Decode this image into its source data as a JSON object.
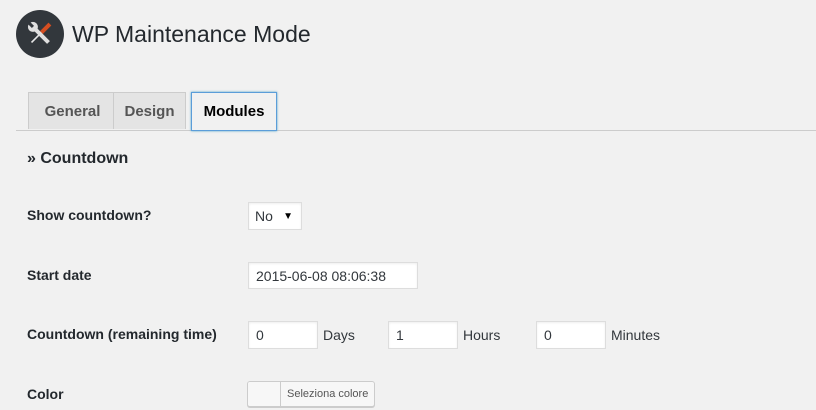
{
  "app": {
    "title": "WP Maintenance Mode",
    "logo_icon": "wrench-screwdriver-icon"
  },
  "tabs": [
    {
      "label": "General",
      "active": false
    },
    {
      "label": "Design",
      "active": false
    },
    {
      "label": "Modules",
      "active": true
    }
  ],
  "section": {
    "title": "» Countdown"
  },
  "fields": {
    "show_countdown": {
      "label": "Show countdown?",
      "value": "No"
    },
    "start_date": {
      "label": "Start date",
      "value": "2015-06-08 08:06:38"
    },
    "remaining": {
      "label": "Countdown (remaining time)",
      "days_value": "0",
      "days_unit": "Days",
      "hours_value": "1",
      "hours_unit": "Hours",
      "minutes_value": "0",
      "minutes_unit": "Minutes"
    },
    "color": {
      "label": "Color",
      "button_label": "Seleziona colore"
    }
  },
  "colors": {
    "tab_active_border": "#5b9dd9",
    "logo_bg": "#32373c",
    "page_bg": "#f1f1f1"
  }
}
